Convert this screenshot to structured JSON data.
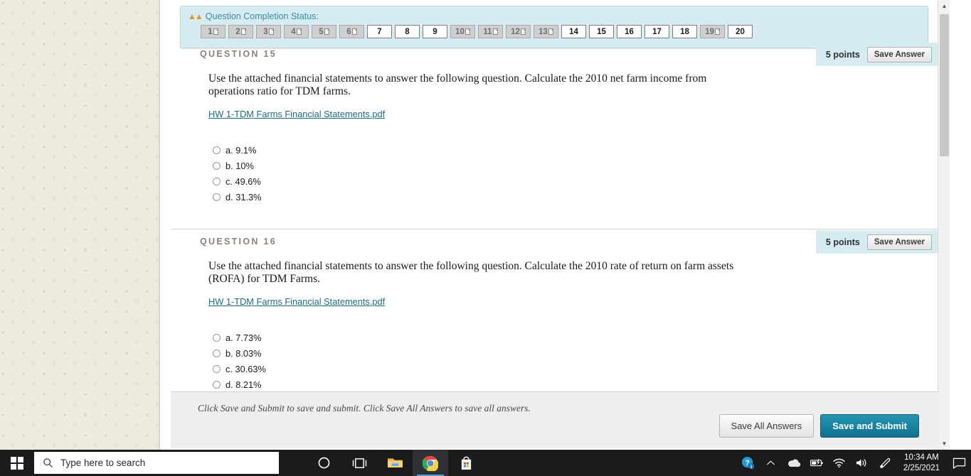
{
  "status_panel": {
    "collapse_icon": "double-chevron-up",
    "title": "Question Completion Status:",
    "buttons": [
      {
        "n": "1",
        "answered": false
      },
      {
        "n": "2",
        "answered": false
      },
      {
        "n": "3",
        "answered": false
      },
      {
        "n": "4",
        "answered": false
      },
      {
        "n": "5",
        "answered": false
      },
      {
        "n": "6",
        "answered": false
      },
      {
        "n": "7",
        "answered": true
      },
      {
        "n": "8",
        "answered": true
      },
      {
        "n": "9",
        "answered": true
      },
      {
        "n": "10",
        "answered": false
      },
      {
        "n": "11",
        "answered": false
      },
      {
        "n": "12",
        "answered": false
      },
      {
        "n": "13",
        "answered": false
      },
      {
        "n": "14",
        "answered": true
      },
      {
        "n": "15",
        "answered": true
      },
      {
        "n": "16",
        "answered": true
      },
      {
        "n": "17",
        "answered": true
      },
      {
        "n": "18",
        "answered": true
      },
      {
        "n": "19",
        "answered": false
      },
      {
        "n": "20",
        "answered": true
      }
    ]
  },
  "questions": [
    {
      "header": "QUESTION 15",
      "points": "5 points",
      "save_label": "Save Answer",
      "text": "Use the attached financial statements to answer the following question. Calculate the 2010 net farm income from operations ratio for TDM farms.",
      "attachment": "HW 1-TDM Farms Financial Statements.pdf",
      "options": [
        {
          "label": "a. 9.1%"
        },
        {
          "label": "b. 10%"
        },
        {
          "label": "c. 49.6%"
        },
        {
          "label": "d. 31.3%"
        }
      ]
    },
    {
      "header": "QUESTION 16",
      "points": "5 points",
      "save_label": "Save Answer",
      "text": "Use the attached financial statements to answer the following question. Calculate the 2010 rate of return on farm assets (ROFA) for TDM Farms.",
      "attachment": "HW 1-TDM Farms Financial Statements.pdf",
      "options": [
        {
          "label": "a. 7.73%"
        },
        {
          "label": "b. 8.03%"
        },
        {
          "label": "c. 30.63%"
        },
        {
          "label": "d. 8.21%"
        }
      ]
    }
  ],
  "submit_bar": {
    "hint": "Click Save and Submit to save and submit. Click Save All Answers to save all answers.",
    "save_all_label": "Save All Answers",
    "save_submit_label": "Save and Submit"
  },
  "scrollbar": {
    "up_glyph": "▲",
    "down_glyph": "▼"
  },
  "taskbar": {
    "start_icon": "windows-logo",
    "search_placeholder": "Type here to search",
    "items": [
      {
        "name": "cortana-icon"
      },
      {
        "name": "task-view-icon"
      },
      {
        "name": "file-explorer-icon"
      },
      {
        "name": "chrome-icon",
        "active": true
      },
      {
        "name": "microsoft-store-icon"
      }
    ],
    "tray": [
      {
        "name": "help-icon"
      },
      {
        "name": "show-hidden-icons-icon"
      },
      {
        "name": "onedrive-icon"
      },
      {
        "name": "battery-icon"
      },
      {
        "name": "wifi-icon"
      },
      {
        "name": "volume-icon"
      },
      {
        "name": "pen-icon"
      }
    ],
    "clock_time": "10:34 AM",
    "clock_date": "2/25/2021",
    "notification_icon": "notification-icon"
  },
  "colors": {
    "panel_bg": "#d6ecf2",
    "link": "#1f6d80",
    "accent_button": "#12718d",
    "header_text": "#8a8278"
  }
}
